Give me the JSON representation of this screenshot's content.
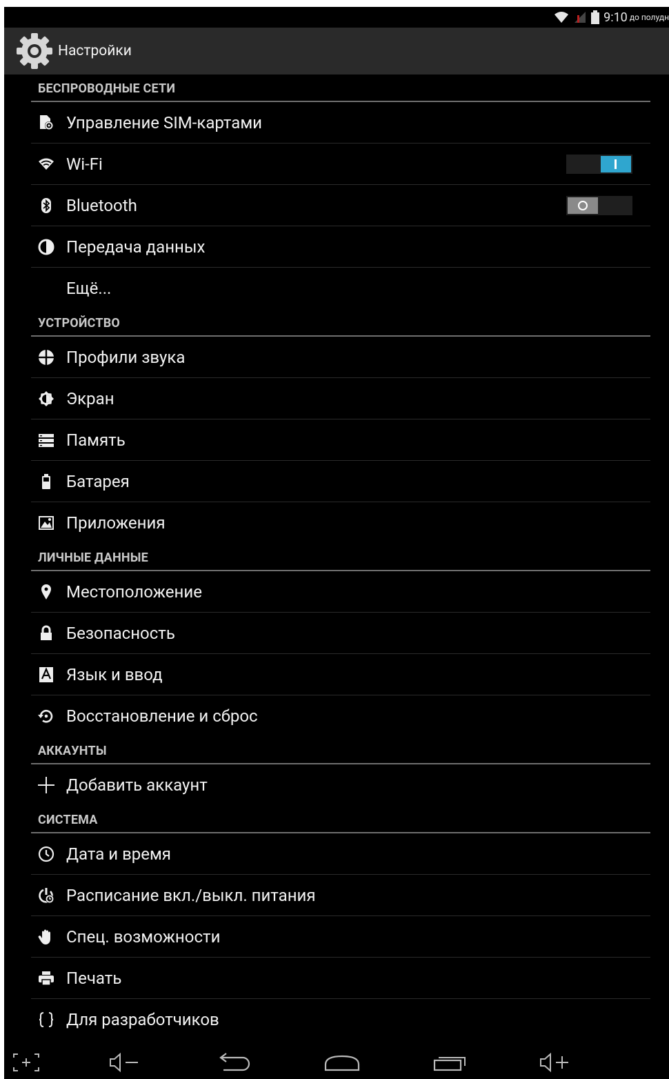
{
  "status_bar": {
    "time": "9:10",
    "ampm": "до полудн"
  },
  "action_bar": {
    "title": "Настройки",
    "icon": "gear-icon"
  },
  "sections": [
    {
      "header": "БЕСПРОВОДНЫЕ СЕТИ",
      "items": [
        {
          "label": "Управление SIM-картами",
          "icon": "sim-card-icon"
        },
        {
          "label": "Wi-Fi",
          "icon": "wifi-icon",
          "toggle": "on"
        },
        {
          "label": "Bluetooth",
          "icon": "bluetooth-icon",
          "toggle": "off"
        },
        {
          "label": "Передача данных",
          "icon": "data-usage-icon"
        },
        {
          "label": "Ещё...",
          "icon": ""
        }
      ]
    },
    {
      "header": "УСТРОЙСТВО",
      "items": [
        {
          "label": "Профили звука",
          "icon": "audio-profiles-icon"
        },
        {
          "label": "Экран",
          "icon": "display-icon"
        },
        {
          "label": "Память",
          "icon": "storage-icon"
        },
        {
          "label": "Батарея",
          "icon": "battery-icon"
        },
        {
          "label": "Приложения",
          "icon": "apps-icon"
        }
      ]
    },
    {
      "header": "ЛИЧНЫЕ ДАННЫЕ",
      "items": [
        {
          "label": "Местоположение",
          "icon": "location-icon"
        },
        {
          "label": "Безопасность",
          "icon": "lock-icon"
        },
        {
          "label": "Язык и ввод",
          "icon": "language-icon"
        },
        {
          "label": "Восстановление и сброс",
          "icon": "backup-restore-icon"
        }
      ]
    },
    {
      "header": "АККАУНТЫ",
      "items": [
        {
          "label": "Добавить аккаунт",
          "icon": "plus-icon"
        }
      ]
    },
    {
      "header": "СИСТЕМА",
      "items": [
        {
          "label": "Дата и время",
          "icon": "clock-icon"
        },
        {
          "label": "Расписание вкл./выкл. питания",
          "icon": "power-schedule-icon"
        },
        {
          "label": "Спец. возможности",
          "icon": "accessibility-hand-icon"
        },
        {
          "label": "Печать",
          "icon": "print-icon"
        },
        {
          "label": "Для разработчиков",
          "icon": "developer-braces-icon"
        }
      ]
    }
  ],
  "nav_bar": [
    "screenshot-icon",
    "volume-down-icon",
    "back-icon",
    "home-icon",
    "recents-icon",
    "volume-up-icon"
  ],
  "colors": {
    "accent": "#2fa6cf",
    "background": "#000000",
    "action_bar": "#2a2a2a",
    "divider": "#6f6f6f"
  }
}
